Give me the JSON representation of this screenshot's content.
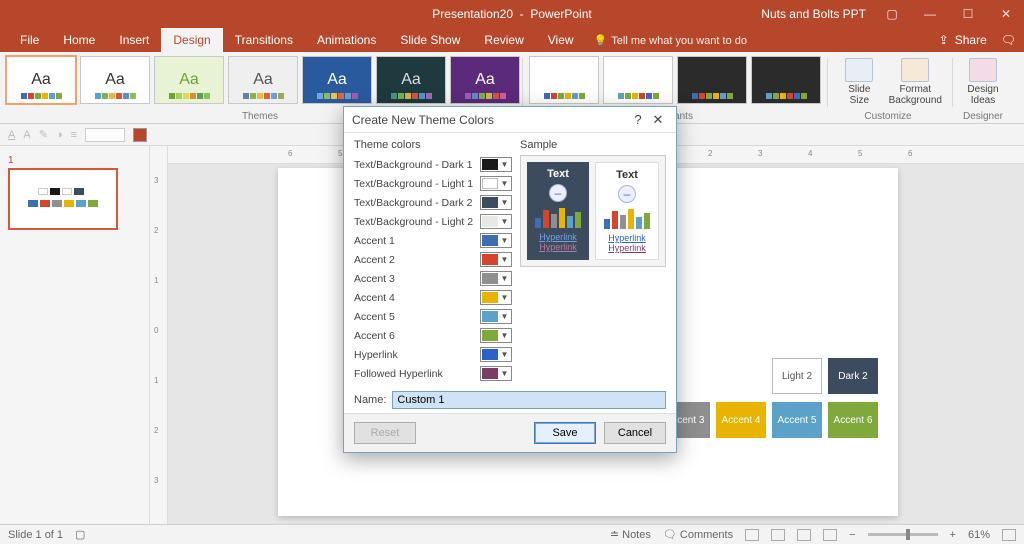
{
  "titlebar": {
    "doc": "Presentation20",
    "app": "PowerPoint",
    "account": "Nuts and Bolts PPT"
  },
  "tabs": {
    "file": "File",
    "home": "Home",
    "insert": "Insert",
    "design": "Design",
    "transitions": "Transitions",
    "animations": "Animations",
    "slideshow": "Slide Show",
    "review": "Review",
    "view": "View",
    "tellme": "Tell me what you want to do",
    "share": "Share"
  },
  "ribbon": {
    "themes_label": "Themes",
    "variants_label": "Variants",
    "slidesize": "Slide\nSize",
    "formatbg": "Format\nBackground",
    "designideas": "Design\nIdeas",
    "customize": "Customize",
    "designer": "Designer"
  },
  "themes": [
    {
      "bg": "#ffffff",
      "fg": "#333",
      "colors": [
        "#3d6db5",
        "#d6452b",
        "#7fa93a",
        "#e8b400",
        "#5aa2c9",
        "#7fa93a"
      ]
    },
    {
      "bg": "#ffffff",
      "fg": "#333",
      "colors": [
        "#59a1cf",
        "#7fb24a",
        "#e6b83b",
        "#d25b3e",
        "#5b8ec9",
        "#8bbf58"
      ]
    },
    {
      "bg": "#e8f3d6",
      "fg": "#6ca32b",
      "colors": [
        "#6ca32b",
        "#a8ce5b",
        "#e6d84a",
        "#d28f3b",
        "#5b9e52",
        "#8bbf58"
      ]
    },
    {
      "bg": "#efefef",
      "fg": "#555",
      "colors": [
        "#5b80b3",
        "#8fae4c",
        "#e3bb45",
        "#d2643e",
        "#6f9ecb",
        "#9fa84c"
      ]
    },
    {
      "bg": "#2a5a9e",
      "fg": "#fff",
      "pattern": true,
      "colors": [
        "#6fa8d8",
        "#8dbb5a",
        "#e7c552",
        "#d86a47",
        "#6f9ecb",
        "#a25bb6"
      ]
    },
    {
      "bg": "#1f3a3f",
      "fg": "#ddd",
      "colors": [
        "#4a8f8a",
        "#7fae4c",
        "#d6b545",
        "#c95b3e",
        "#5b8ec9",
        "#9f6bb6"
      ]
    },
    {
      "bg": "#5b2a7a",
      "fg": "#fff",
      "colors": [
        "#a25bb6",
        "#5b8ec9",
        "#7fae4c",
        "#d6b545",
        "#c95b3e",
        "#d65ba2"
      ]
    }
  ],
  "variants": [
    {
      "bg": "#ffffff",
      "colors": [
        "#3d6db5",
        "#d6452b",
        "#7fa93a",
        "#e8b400",
        "#5aa2c9",
        "#7fa93a"
      ]
    },
    {
      "bg": "#ffffff",
      "colors": [
        "#5aa2c9",
        "#7fa93a",
        "#e8b400",
        "#d6452b",
        "#3d6db5",
        "#7fa93a"
      ]
    },
    {
      "bg": "#2b2b2b",
      "colors": [
        "#3d6db5",
        "#d6452b",
        "#7fa93a",
        "#e8b400",
        "#5aa2c9",
        "#7fa93a"
      ]
    },
    {
      "bg": "#2b2b2b",
      "colors": [
        "#5aa2c9",
        "#7fa93a",
        "#e8b400",
        "#d6452b",
        "#3d6db5",
        "#7fa93a"
      ]
    }
  ],
  "dialog": {
    "title": "Create New Theme Colors",
    "help": "?",
    "themecolors_hdr": "Theme colors",
    "sample_hdr": "Sample",
    "rows": [
      {
        "label": "Text/Background - Dark 1",
        "color": "#1a1a1a"
      },
      {
        "label": "Text/Background - Light 1",
        "color": "#ffffff"
      },
      {
        "label": "Text/Background - Dark 2",
        "color": "#3d4b5e"
      },
      {
        "label": "Text/Background - Light 2",
        "color": "#e8e8e4"
      },
      {
        "label": "Accent 1",
        "color": "#3d6db5"
      },
      {
        "label": "Accent 2",
        "color": "#d6452b"
      },
      {
        "label": "Accent 3",
        "color": "#8f8f8f"
      },
      {
        "label": "Accent 4",
        "color": "#e8b400"
      },
      {
        "label": "Accent 5",
        "color": "#5aa2c9"
      },
      {
        "label": "Accent 6",
        "color": "#7fa93a"
      },
      {
        "label": "Hyperlink",
        "color": "#2a62c9"
      },
      {
        "label": "Followed Hyperlink",
        "color": "#7a3d66"
      }
    ],
    "sample_text": "Text",
    "sample_hyper": "Hyperlink",
    "name_label": "Name:",
    "name_value": "Custom 1",
    "reset": "Reset",
    "save": "Save",
    "cancel": "Cancel"
  },
  "slide_tiles": {
    "row1": [
      {
        "label": "Light 2",
        "bg": "#ffffff",
        "fg": "#555",
        "border": "#bbb"
      },
      {
        "label": "Dark 2",
        "bg": "#3d4b5e",
        "fg": "#fff"
      }
    ],
    "row2": [
      {
        "label": "Accent 3",
        "bg": "#8f8f8f"
      },
      {
        "label": "Accent 4",
        "bg": "#e8b400"
      },
      {
        "label": "Accent 5",
        "bg": "#5aa2c9"
      },
      {
        "label": "Accent 6",
        "bg": "#7fa93a"
      }
    ]
  },
  "status": {
    "slide": "Slide 1 of 1",
    "notes": "Notes",
    "comments": "Comments",
    "zoom": "61%"
  }
}
